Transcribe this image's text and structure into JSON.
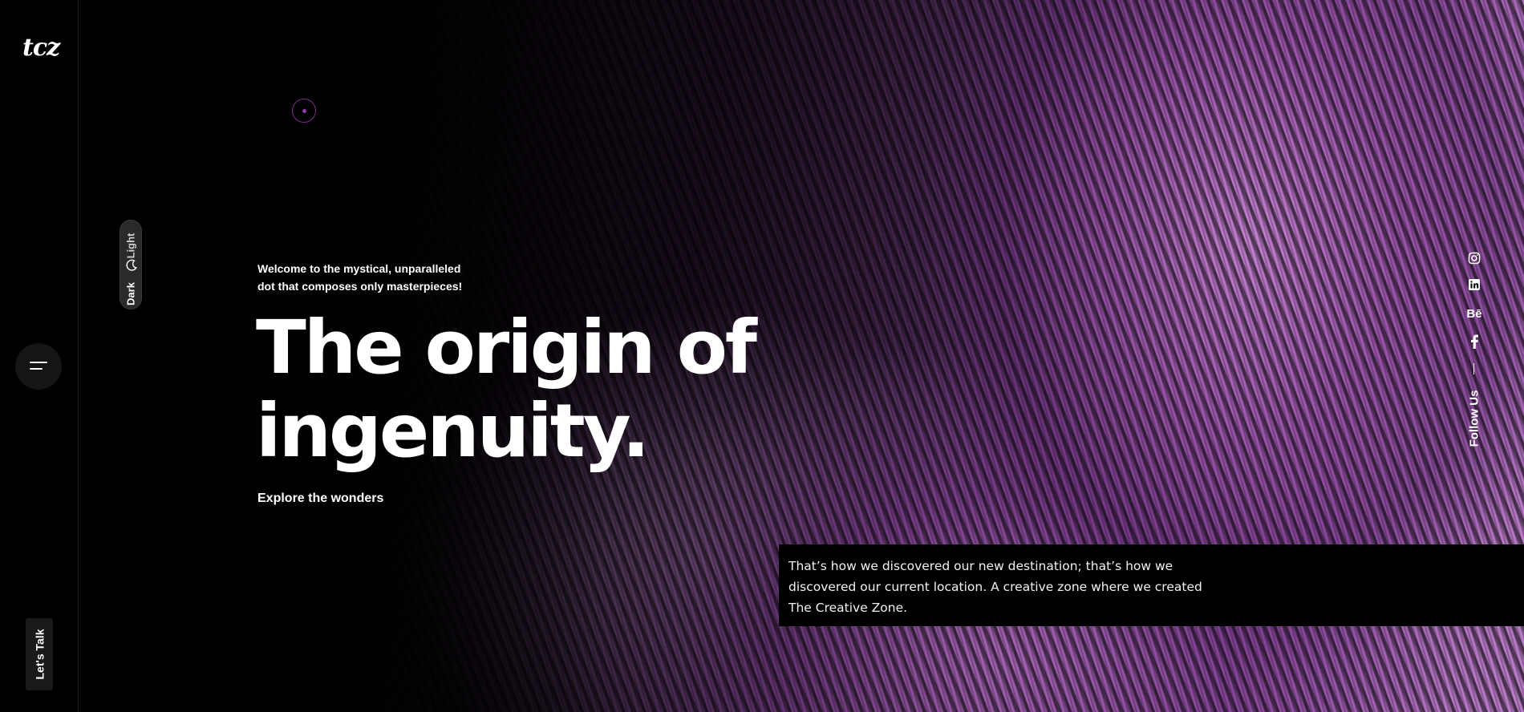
{
  "brand": {
    "logo_text": "tcz"
  },
  "sidebar": {
    "menu_icon": "hamburger-menu-icon",
    "lets_talk_label": "Let's Talk"
  },
  "theme_toggle": {
    "light_label": "Light",
    "dark_label": "Dark",
    "icon": "moon-icon",
    "selected": "Dark"
  },
  "hero": {
    "intro": "Welcome to the mystical, unparalleled dot that composes only masterpieces!",
    "headline_line1": "The origin of",
    "headline_line2": "ingenuity.",
    "explore_label": "Explore the wonders"
  },
  "social": {
    "items": [
      {
        "name": "instagram",
        "icon": "instagram-icon"
      },
      {
        "name": "linkedin",
        "icon": "linkedin-icon"
      },
      {
        "name": "behance",
        "icon": "behance-icon",
        "text": "Bē"
      },
      {
        "name": "facebook",
        "icon": "facebook-icon"
      }
    ],
    "follow_label": "Follow Us"
  },
  "quote": {
    "text": "That’s how we discovered our new destination; that’s how we discovered our current location. A creative zone where we created The Creative Zone."
  },
  "colors": {
    "background": "#000000",
    "accent_purple": "#b46cc6",
    "cursor_ring": "#7e2d8f"
  }
}
